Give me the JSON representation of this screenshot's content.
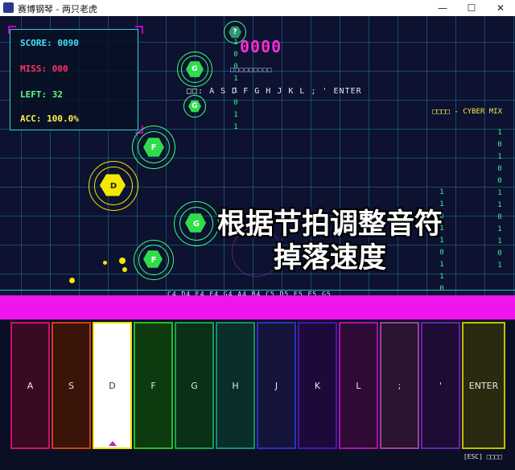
{
  "window": {
    "title": "赛博钢琴 - 两只老虎",
    "controls": {
      "minimize": "—",
      "maximize": "☐",
      "close": "✕"
    }
  },
  "hud": {
    "score": "SCORE: 0090",
    "miss": "MISS: 000",
    "left": "LEFT: 32",
    "acc": "ACC: 100.0%"
  },
  "combo": {
    "value": "0000",
    "sub": "□□□□□□□□□"
  },
  "key_hint": "□□: A S D F G H J K L ; ' ENTER",
  "song_title": "□□□□ - CYBER MIX",
  "caption": {
    "line1": "根据节拍调整音符",
    "line2": "掉落速度"
  },
  "note_names": "C4 D4 E4 F4 G4 A4 B4 C5 D5 E5 F5 G5",
  "falling_notes": [
    {
      "label": "?"
    },
    {
      "label": "G"
    },
    {
      "label": "G"
    },
    {
      "label": "F"
    },
    {
      "label": "D"
    },
    {
      "label": "G"
    },
    {
      "label": "F"
    }
  ],
  "keys": [
    {
      "label": "A",
      "color": "#d0106a",
      "fill": "#3a0a24",
      "pressed": false
    },
    {
      "label": "S",
      "color": "#d04010",
      "fill": "#3a1408",
      "pressed": false
    },
    {
      "label": "D",
      "color": "#f0e000",
      "fill": "#ffffff",
      "pressed": true
    },
    {
      "label": "F",
      "color": "#20c020",
      "fill": "#0e3a10",
      "pressed": false
    },
    {
      "label": "G",
      "color": "#10a840",
      "fill": "#0a3018",
      "pressed": false
    },
    {
      "label": "H",
      "color": "#109070",
      "fill": "#0a2e2a",
      "pressed": false
    },
    {
      "label": "J",
      "color": "#3030c0",
      "fill": "#14143a",
      "pressed": false
    },
    {
      "label": "K",
      "color": "#5010b0",
      "fill": "#1e0a3a",
      "pressed": false
    },
    {
      "label": "L",
      "color": "#b010b0",
      "fill": "#2e0a34",
      "pressed": false
    },
    {
      "label": ";",
      "color": "#a040a0",
      "fill": "#2a1430",
      "pressed": false
    },
    {
      "label": "'",
      "color": "#7020b0",
      "fill": "#1e0c34",
      "pressed": false
    },
    {
      "label": "ENTER",
      "color": "#c0c000",
      "fill": "#2a2a10",
      "pressed": false
    }
  ],
  "esc_hint": "[ESC] □□□□",
  "colors": {
    "score": "#44e0ff",
    "miss": "#ff3366",
    "left": "#5cff7a",
    "acc": "#fff04a",
    "hit_bar": "#ef15ef"
  }
}
